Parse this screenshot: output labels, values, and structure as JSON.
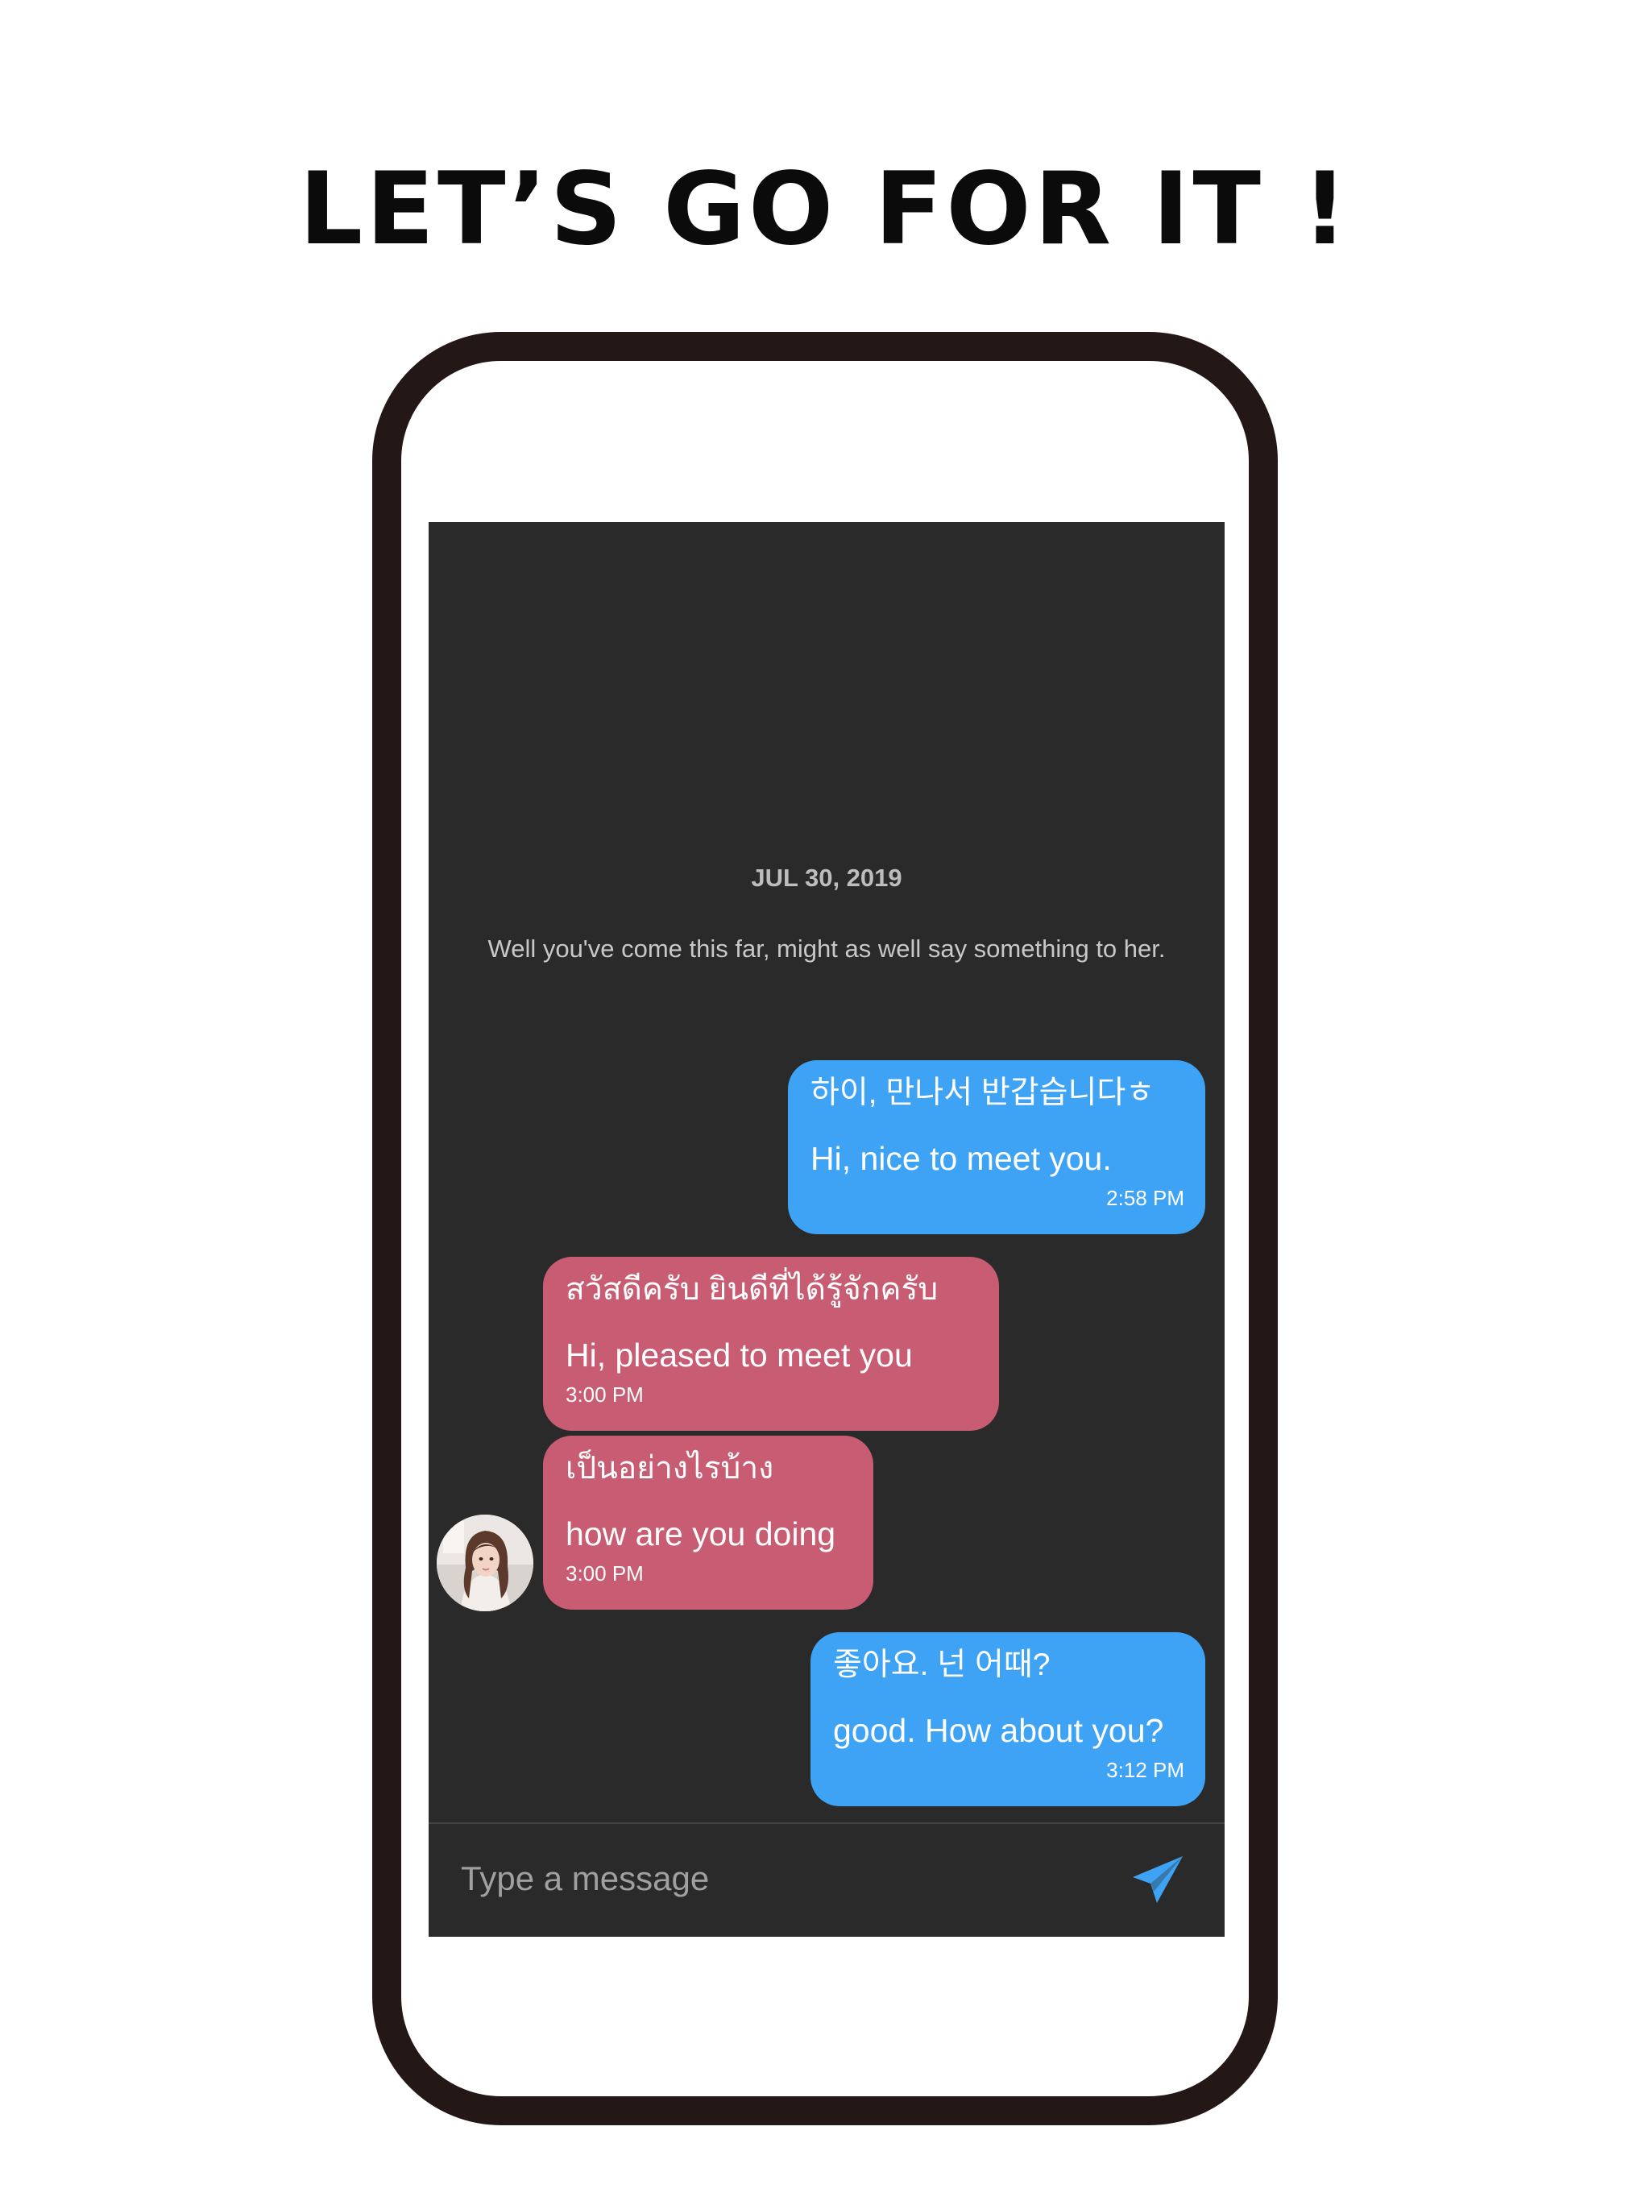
{
  "headline": "LET’S GO FOR IT !",
  "chat": {
    "date": "JUL 30, 2019",
    "hint": "Well you've come this far, might as well say something to her.",
    "messages": [
      {
        "direction": "outgoing",
        "original": "하이, 만나서 반갑습니다ㅎ",
        "translation": "Hi, nice to meet you.",
        "time": "2:58 PM"
      },
      {
        "direction": "incoming",
        "original": "สวัสดีครับ ยินดีที่ได้รู้จักครับ",
        "translation": "Hi, pleased to meet you",
        "time": "3:00 PM"
      },
      {
        "direction": "incoming",
        "original": "เป็นอย่างไรบ้าง",
        "translation": "how are you doing",
        "time": "3:00 PM"
      },
      {
        "direction": "outgoing",
        "original": "좋아요. 넌 어때?",
        "translation": "good. How about you?",
        "time": "3:12 PM"
      }
    ]
  },
  "composer": {
    "placeholder": "Type a message",
    "send_icon": "send-icon"
  },
  "colors": {
    "outgoing_bubble": "#3fa3f5",
    "incoming_bubble": "#c85c73",
    "screen_background": "#2a2a2a",
    "send_icon": "#3fa3f5",
    "frame": "#231816"
  }
}
